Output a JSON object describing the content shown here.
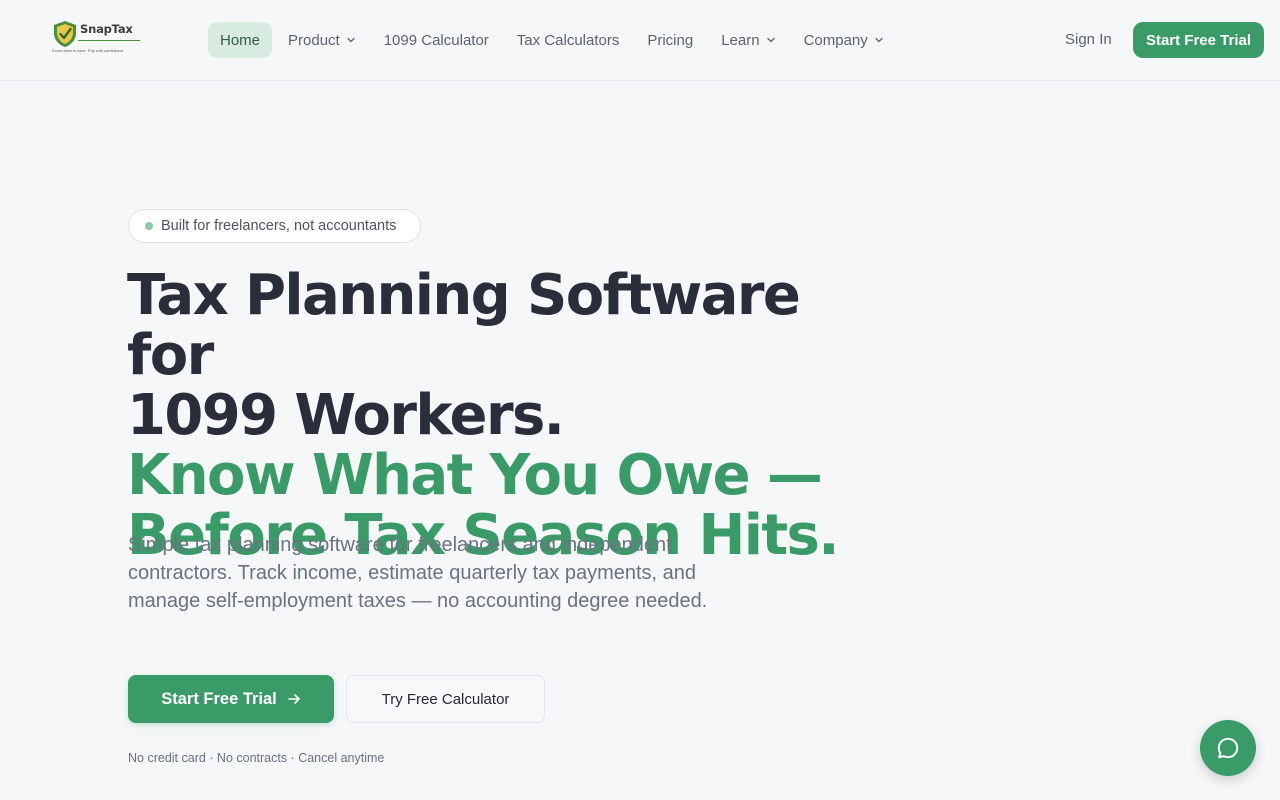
{
  "brand": {
    "name": "SnapTax",
    "tagline": "Know what to save. Pay with confidence.",
    "colors": {
      "primary": "#3a9a68",
      "shield": "#4c8f3d",
      "active_nav_bg": "#d8ebe0"
    }
  },
  "nav": {
    "items": [
      {
        "label": "Home",
        "active": true,
        "dropdown": false
      },
      {
        "label": "Product",
        "active": false,
        "dropdown": true
      },
      {
        "label": "1099 Calculator",
        "active": false,
        "dropdown": false
      },
      {
        "label": "Tax Calculators",
        "active": false,
        "dropdown": false
      },
      {
        "label": "Pricing",
        "active": false,
        "dropdown": false
      },
      {
        "label": "Learn",
        "active": false,
        "dropdown": true
      },
      {
        "label": "Company",
        "active": false,
        "dropdown": true
      }
    ],
    "sign_in": "Sign In",
    "cta": "Start Free Trial"
  },
  "hero": {
    "badge": "Built for freelancers, not accountants",
    "headline_line1": "Tax Planning Software for",
    "headline_line2": "1099 Workers.",
    "headline_line3": "Know What You Owe —",
    "headline_line4": "Before Tax Season Hits.",
    "subtitle": "Simple tax planning software for freelancers and independent contractors. Track income, estimate quarterly tax payments, and manage self-employment taxes — no accounting degree needed.",
    "primary_cta": "Start Free Trial",
    "secondary_cta": "Try Free Calculator",
    "fineprint": "No credit card · No contracts · Cancel anytime"
  },
  "icons": {
    "logo": "shield-logo-icon",
    "dropdown": "chevron-down-icon",
    "cta_arrow": "arrow-right-icon",
    "chat": "chat-bubble-icon"
  }
}
